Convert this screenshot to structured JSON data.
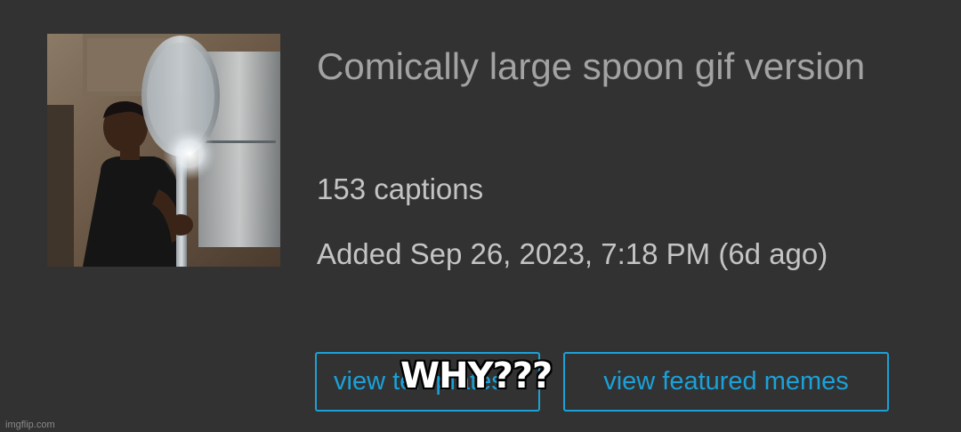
{
  "template": {
    "title": "Comically large spoon gif version",
    "captions": "153 captions",
    "added": "Added Sep 26, 2023, 7:18 PM (6d ago)",
    "thumbnail_icon": "man-with-giant-spoon-image"
  },
  "buttons": {
    "view_templates": "view templates",
    "view_featured": "view featured memes"
  },
  "overlay_caption": "WHY???",
  "watermark": "imgflip.com",
  "colors": {
    "background": "#323232",
    "title": "#a3a3a3",
    "meta_text": "#c4c4c4",
    "accent": "#1ba1d8"
  }
}
